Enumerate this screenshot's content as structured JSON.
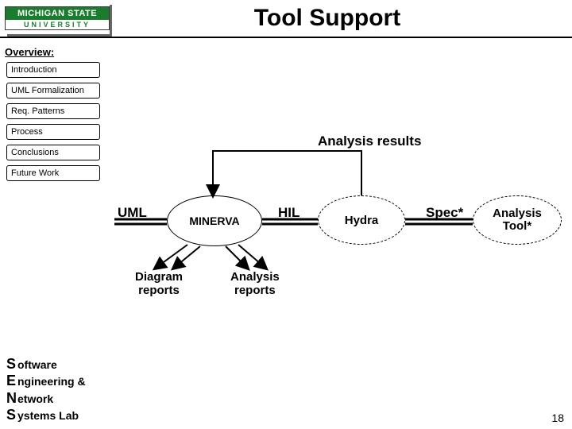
{
  "header": {
    "logo_top": "MICHIGAN STATE",
    "logo_bottom": "UNIVERSITY",
    "title": "Tool Support"
  },
  "overview_label": "Overview:",
  "nav": [
    "Introduction",
    "UML Formalization",
    "Req. Patterns",
    "Process",
    "Conclusions",
    "Future Work"
  ],
  "diagram": {
    "analysis_results": "Analysis results",
    "uml": "UML",
    "hil": "HIL",
    "spec": "Spec*",
    "minerva": "MINERVA",
    "hydra": "Hydra",
    "analysis_tool_l1": "Analysis",
    "analysis_tool_l2": "Tool*",
    "diagram_reports_l1": "Diagram",
    "diagram_reports_l2": "reports",
    "analysis_reports_l1": "Analysis",
    "analysis_reports_l2": "reports"
  },
  "footer": {
    "s": "S",
    "s_rest": "oftware",
    "e": "E",
    "e_rest": "ngineering &",
    "n": "N",
    "n_rest": "etwork",
    "y": "S",
    "y_rest": "ystems Lab"
  },
  "page_number": "18"
}
